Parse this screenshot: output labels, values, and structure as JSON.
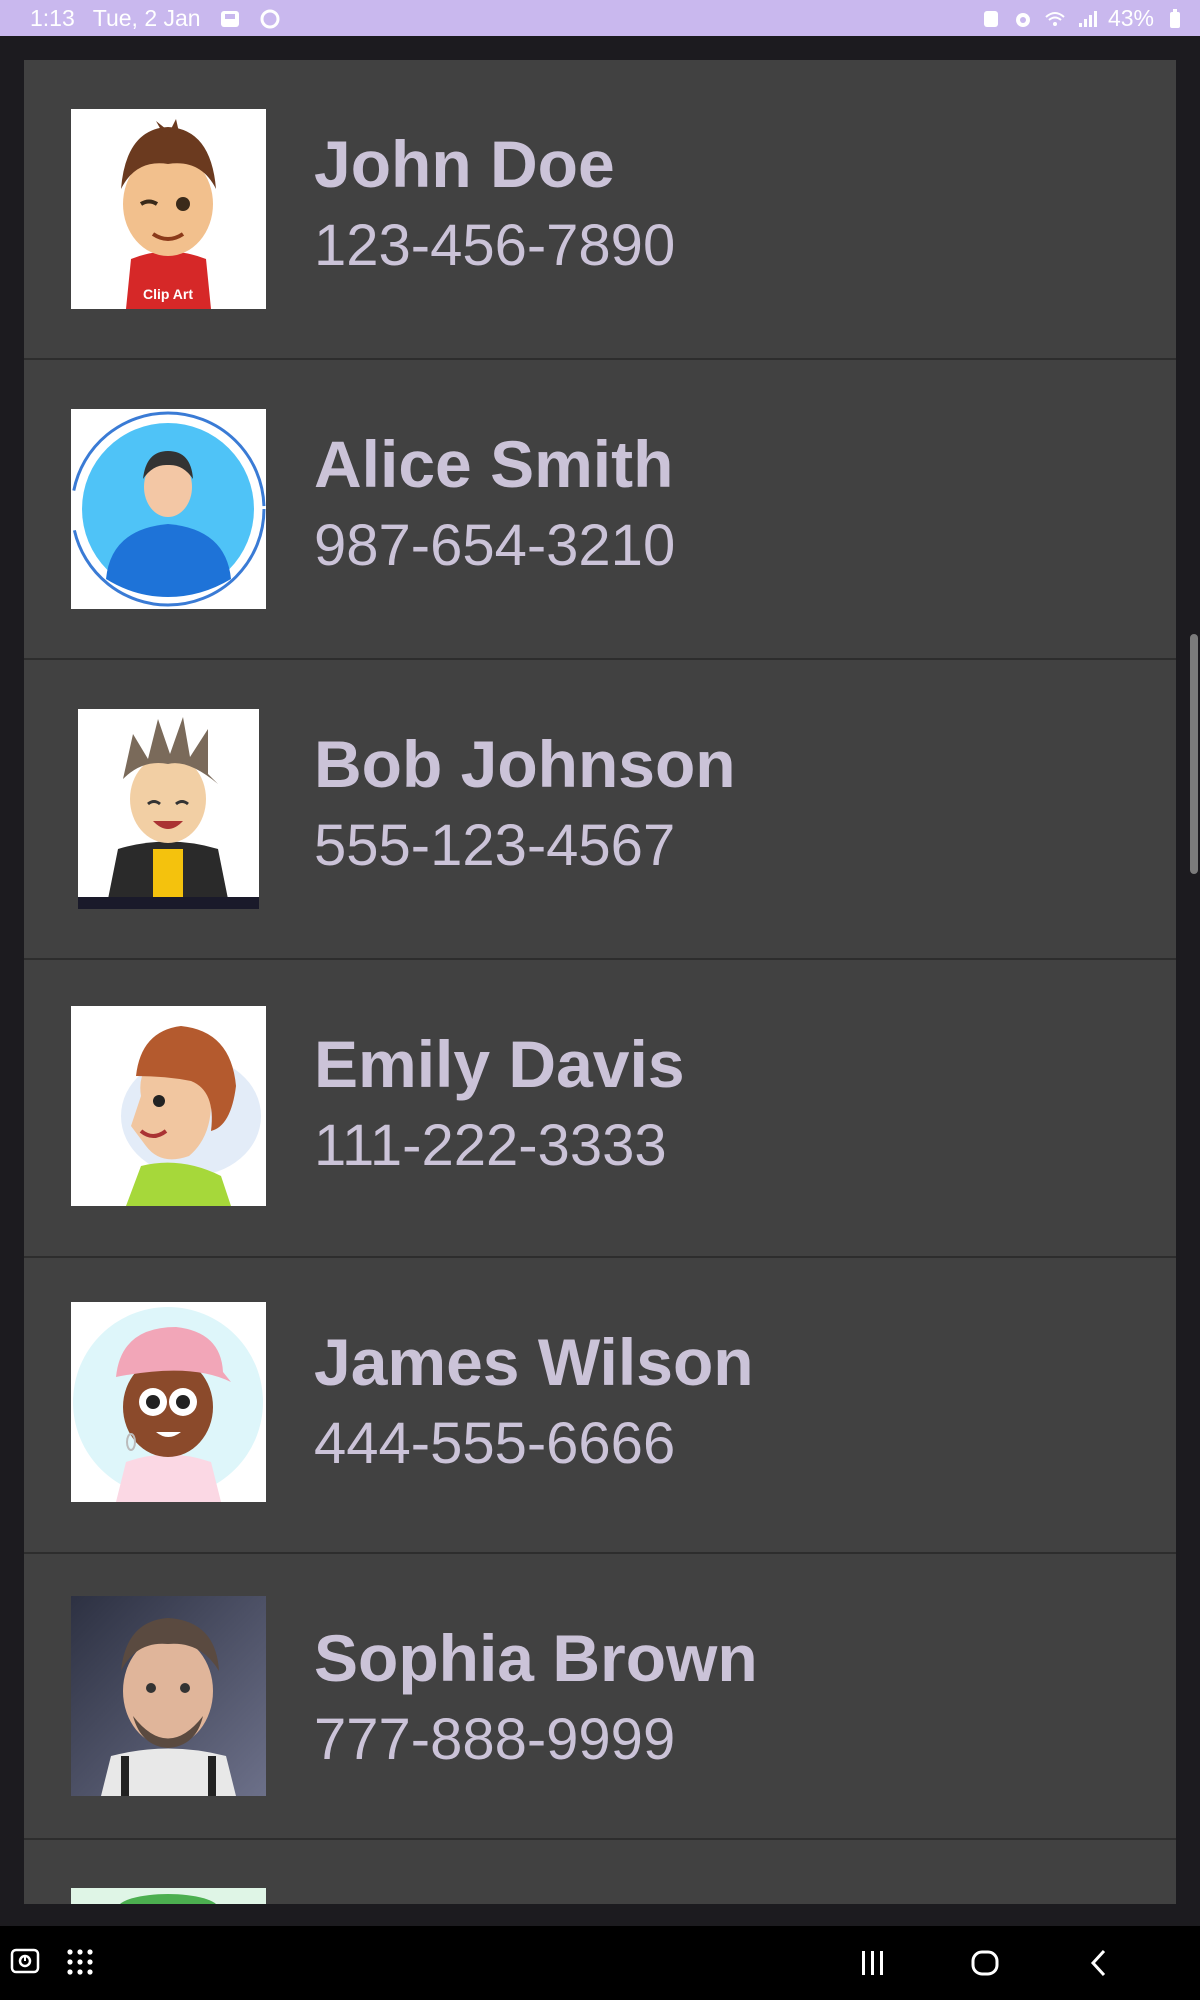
{
  "status_bar": {
    "time": "1:13",
    "date": "Tue, 2 Jan",
    "battery": "43%"
  },
  "contacts": [
    {
      "name": "John Doe",
      "phone": "123-456-7890",
      "avatar": "clipart-boy-red-shirt-winking"
    },
    {
      "name": "Alice Smith",
      "phone": "987-654-3210",
      "avatar": "man-blue-shirt-circle"
    },
    {
      "name": "Bob Johnson",
      "phone": "555-123-4567",
      "avatar": "cartoon-boy-spiky-hair"
    },
    {
      "name": "Emily Davis",
      "phone": "111-222-3333",
      "avatar": "cartoon-boy-profile-green-shirt"
    },
    {
      "name": "James Wilson",
      "phone": "444-555-6666",
      "avatar": "cartoon-girl-pink-cap"
    },
    {
      "name": "Sophia Brown",
      "phone": "777-888-9999",
      "avatar": "3d-man-beard"
    }
  ],
  "avatar_labels": {
    "clip_art": "Clip Art"
  },
  "colors": {
    "status_bar": "#c9b8ee",
    "list_background": "#414141",
    "text": "#cbc3d8",
    "screen_background": "#1c1b1f"
  },
  "nav_bar": {
    "items": [
      "recent-apps-icon",
      "home-icon",
      "back-icon"
    ]
  }
}
